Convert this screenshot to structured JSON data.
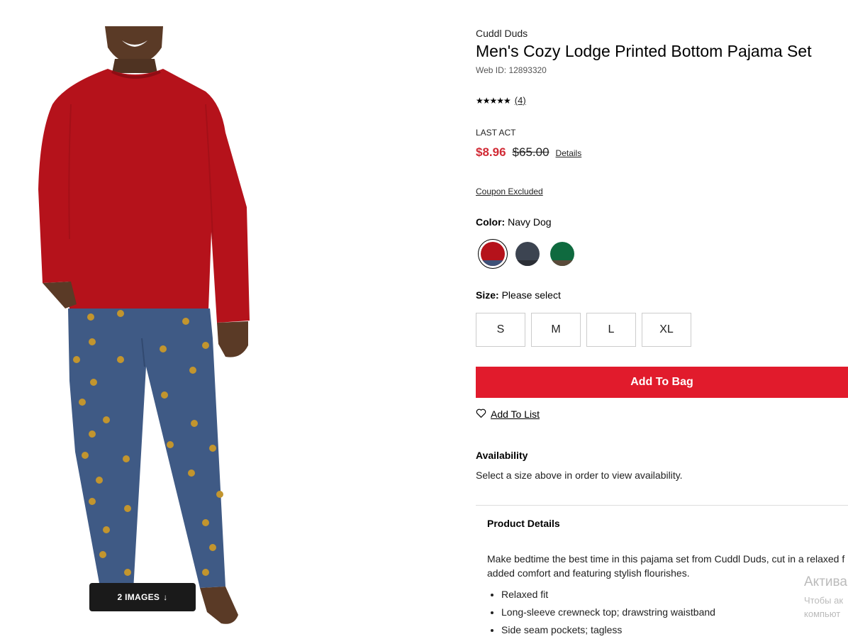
{
  "gallery": {
    "images_badge": "2 IMAGES",
    "badge_icon": "arrow-down-icon"
  },
  "product": {
    "brand": "Cuddl Duds",
    "title": "Men's Cozy Lodge Printed Bottom Pajama Set",
    "web_id": "Web ID: 12893320",
    "rating": {
      "stars": "★★★★★",
      "stars_value": 5,
      "count": "(4)"
    },
    "promo_label": "LAST ACT",
    "price": {
      "sale": "$8.96",
      "original": "$65.00",
      "details_link": "Details",
      "sale_color": "#d12a35"
    },
    "coupon": "Coupon Excluded",
    "color": {
      "label": "Color:",
      "selected": "Navy Dog",
      "swatches": [
        {
          "name": "red-swatch",
          "color": "#b5121b",
          "band": "#3d5178"
        },
        {
          "name": "navy-swatch",
          "color": "#3c4451",
          "band": "#2b2f36"
        },
        {
          "name": "green-swatch",
          "color": "#0f6a3f",
          "band": "#5a4a3a"
        }
      ]
    },
    "size": {
      "label": "Size:",
      "selected": "Please select",
      "options": [
        "S",
        "M",
        "L",
        "XL"
      ]
    },
    "add_to_bag": "Add To Bag",
    "add_to_bag_color": "#e11b2c",
    "add_to_list": "Add To List",
    "availability": {
      "title": "Availability",
      "text": "Select a size above in order to view availability."
    },
    "details": {
      "title": "Product Details",
      "description_line1": "Make bedtime the best time in this pajama set from Cuddl Duds, cut in a relaxed f",
      "description_line2": "added comfort and featuring stylish flourishes.",
      "bullets": [
        "Relaxed fit",
        "Long-sleeve crewneck top; drawstring waistband",
        "Side seam pockets; tagless"
      ]
    }
  },
  "watermark": {
    "line1": "Актива",
    "line2": "Чтобы ак",
    "line3": "компьют"
  }
}
